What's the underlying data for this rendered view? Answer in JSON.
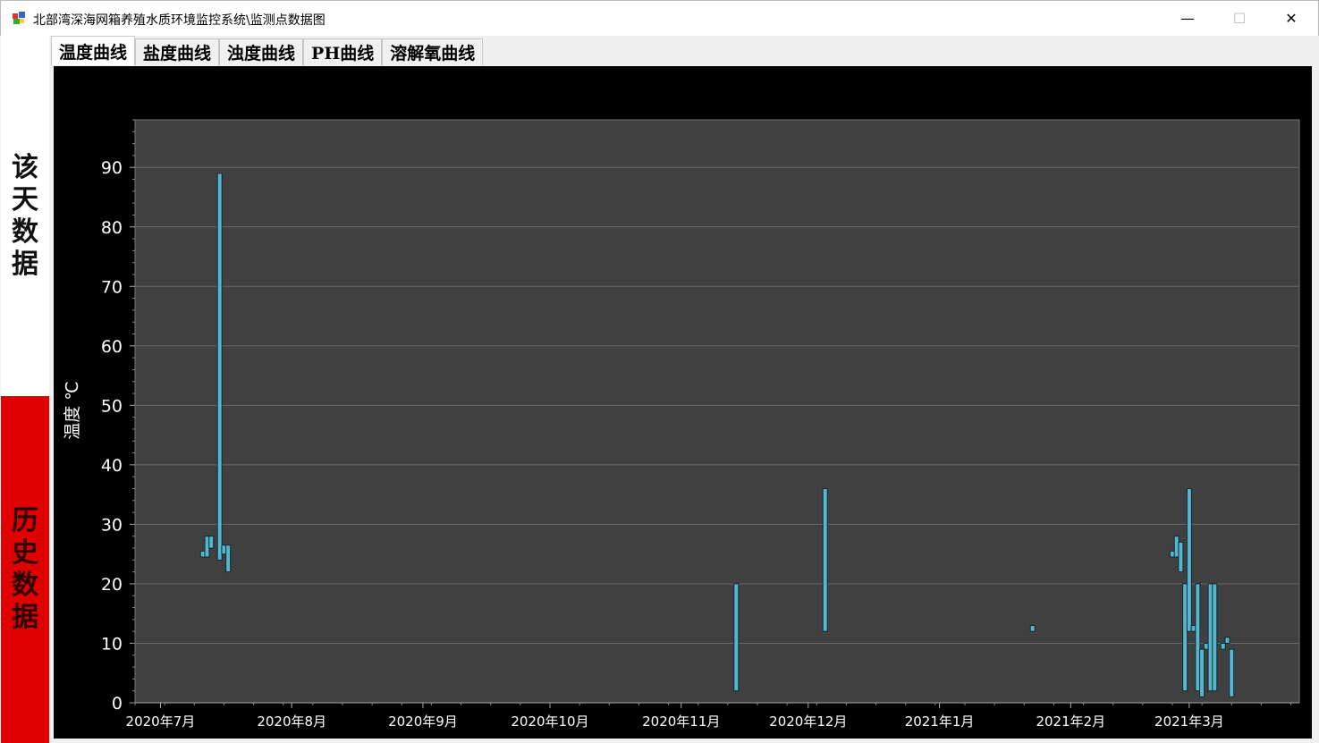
{
  "window": {
    "title": "北部湾深海网箱养殖水质环境监控系统\\监测点数据图",
    "minimize": "—",
    "maximize": "☐",
    "close": "✕"
  },
  "left_panel": {
    "today": "该天数据",
    "history": "历史数据"
  },
  "tabs": [
    {
      "label": "温度曲线",
      "active": true
    },
    {
      "label": "盐度曲线"
    },
    {
      "label": "浊度曲线"
    },
    {
      "label": "PH曲线"
    },
    {
      "label": "溶解氧曲线"
    }
  ],
  "colors": {
    "bar_fill": "#5ab4cc",
    "bar_stroke": "#0a2a33",
    "plot_bg": "#404040",
    "grid": "#6a6a6a"
  },
  "chart_data": {
    "type": "range-bar",
    "ylabel": "温度 ℃",
    "ylim": [
      0,
      98
    ],
    "yticks": [
      0,
      10,
      20,
      30,
      40,
      50,
      60,
      70,
      80,
      90
    ],
    "xlim": [
      "2020-06-25",
      "2021-03-27"
    ],
    "xticks": [
      {
        "date": "2020-07-01",
        "label": "2020年7月"
      },
      {
        "date": "2020-08-01",
        "label": "2020年8月"
      },
      {
        "date": "2020-09-01",
        "label": "2020年9月"
      },
      {
        "date": "2020-10-01",
        "label": "2020年10月"
      },
      {
        "date": "2020-11-01",
        "label": "2020年11月"
      },
      {
        "date": "2020-12-01",
        "label": "2020年12月"
      },
      {
        "date": "2021-01-01",
        "label": "2021年1月"
      },
      {
        "date": "2021-02-01",
        "label": "2021年2月"
      },
      {
        "date": "2021-03-01",
        "label": "2021年3月"
      }
    ],
    "bars": [
      {
        "date": "2020-07-11",
        "low": 24.5,
        "high": 25.5
      },
      {
        "date": "2020-07-12",
        "low": 24.5,
        "high": 28
      },
      {
        "date": "2020-07-13",
        "low": 26,
        "high": 28
      },
      {
        "date": "2020-07-15",
        "low": 24,
        "high": 89
      },
      {
        "date": "2020-07-16",
        "low": 25,
        "high": 26.5
      },
      {
        "date": "2020-07-17",
        "low": 22,
        "high": 26.5
      },
      {
        "date": "2020-11-14",
        "low": 2,
        "high": 20
      },
      {
        "date": "2020-12-05",
        "low": 12,
        "high": 36
      },
      {
        "date": "2021-01-23",
        "low": 12,
        "high": 13
      },
      {
        "date": "2021-02-25",
        "low": 24.5,
        "high": 25.5
      },
      {
        "date": "2021-02-26",
        "low": 24.5,
        "high": 28
      },
      {
        "date": "2021-02-27",
        "low": 22,
        "high": 27
      },
      {
        "date": "2021-02-28",
        "low": 2,
        "high": 20
      },
      {
        "date": "2021-03-01",
        "low": 12,
        "high": 36
      },
      {
        "date": "2021-03-02",
        "low": 12,
        "high": 13
      },
      {
        "date": "2021-03-03",
        "low": 2,
        "high": 20
      },
      {
        "date": "2021-03-04",
        "low": 1,
        "high": 9
      },
      {
        "date": "2021-03-05",
        "low": 9,
        "high": 10
      },
      {
        "date": "2021-03-06",
        "low": 2,
        "high": 20
      },
      {
        "date": "2021-03-07",
        "low": 2,
        "high": 20
      },
      {
        "date": "2021-03-09",
        "low": 9,
        "high": 10
      },
      {
        "date": "2021-03-10",
        "low": 10,
        "high": 11
      },
      {
        "date": "2021-03-11",
        "low": 1,
        "high": 9
      }
    ]
  }
}
